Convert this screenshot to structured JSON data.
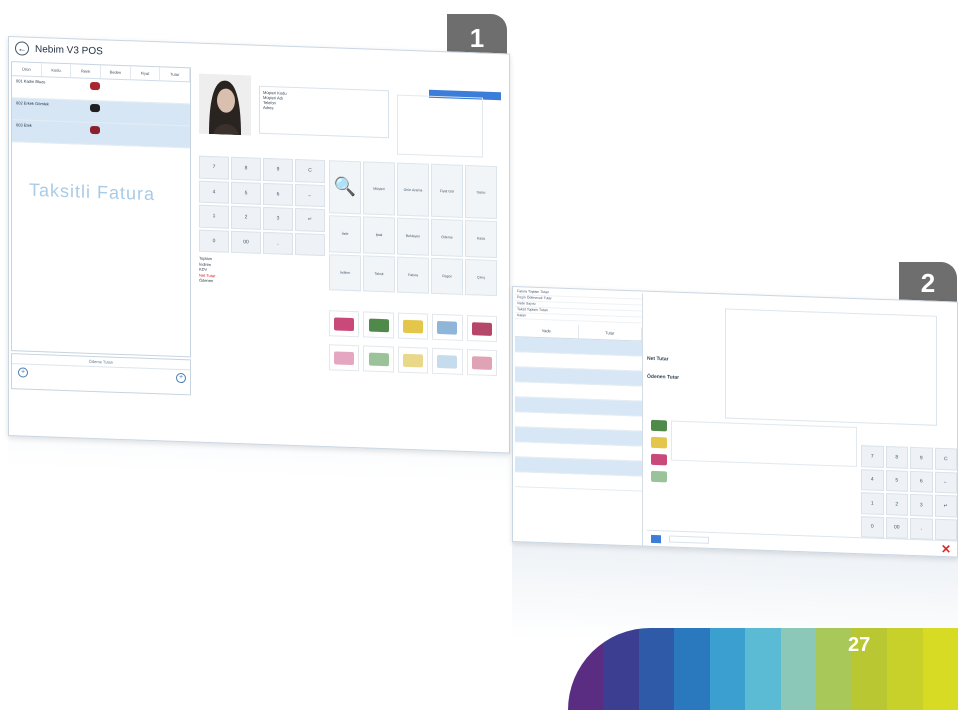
{
  "badges": {
    "first": "1",
    "second": "2"
  },
  "page_number": "27",
  "pos1": {
    "title": "Nebim V3 POS",
    "watermark": "Taksitli Fatura",
    "cart_headers": [
      "Ürün",
      "Kodu",
      "Renk",
      "Beden",
      "Fiyat",
      "Tutar"
    ],
    "cart_items": [
      {
        "name": "001 Kadın Bluzu"
      },
      {
        "name": "002 Erkek Gömlek"
      },
      {
        "name": "003 Etek"
      }
    ],
    "footer_bar": "Ödeme Tutarı",
    "info_lines": [
      "Müşteri Kodu",
      "Müşteri Adı",
      "Telefon",
      "Adres"
    ],
    "keypad": [
      "7",
      "8",
      "9",
      "C",
      "4",
      "5",
      "6",
      "←",
      "1",
      "2",
      "3",
      "↵",
      "0",
      "00",
      ",",
      ""
    ],
    "summary": [
      {
        "label": "Toplam",
        "value": ""
      },
      {
        "label": "İndirim",
        "value": ""
      },
      {
        "label": "KDV",
        "value": ""
      },
      {
        "label": "Net Tutar",
        "value": "",
        "red": true
      },
      {
        "label": "Ödenen",
        "value": ""
      }
    ],
    "fn_keys": [
      "",
      "Müşteri",
      "Ürün Arama",
      "Fiyat Gör",
      "Satıcı",
      "İade",
      "İptal",
      "Bekleyen",
      "Ödeme",
      "Kasa",
      "İndirim",
      "Taksit",
      "Fatura",
      "Rapor",
      "Çıkış"
    ],
    "search_glyph": "🔍"
  },
  "pos2": {
    "summary_rows": [
      {
        "label": "Fatura Toplam Tutarı",
        "value": ""
      },
      {
        "label": "Peşin Ödenecek Tutar",
        "value": ""
      },
      {
        "label": "Vade Sayısı",
        "value": ""
      },
      {
        "label": "Taksit Toplam Tutarı",
        "value": ""
      },
      {
        "label": "Kalan",
        "value": ""
      }
    ],
    "list_headers": [
      "Vade",
      "Tutar"
    ],
    "installments": [
      {
        "date": "",
        "amount": ""
      },
      {
        "date": "",
        "amount": ""
      },
      {
        "date": "",
        "amount": ""
      },
      {
        "date": "",
        "amount": ""
      },
      {
        "date": "",
        "amount": ""
      },
      {
        "date": "",
        "amount": ""
      },
      {
        "date": "",
        "amount": ""
      },
      {
        "date": "",
        "amount": ""
      },
      {
        "date": "",
        "amount": ""
      },
      {
        "date": "",
        "amount": ""
      }
    ],
    "net_label": "Net Tutar",
    "paid_label": "Ödenen Tutar",
    "keys": [
      "7",
      "8",
      "9",
      "C",
      "4",
      "5",
      "6",
      "←",
      "1",
      "2",
      "3",
      "↵",
      "0",
      "00",
      ",",
      ""
    ],
    "footer_field": ""
  },
  "colors": {
    "accent": "#3b7dd8",
    "selection": "#d6e6f5",
    "alert": "#d62d2d",
    "rainbow": [
      "#5a2d82",
      "#3c3e92",
      "#2f5aa8",
      "#2a78bd",
      "#3ba0cf",
      "#5cbbd4",
      "#8cc8b8",
      "#a8c85a",
      "#b9c832",
      "#c7d12a",
      "#d8db24"
    ]
  }
}
